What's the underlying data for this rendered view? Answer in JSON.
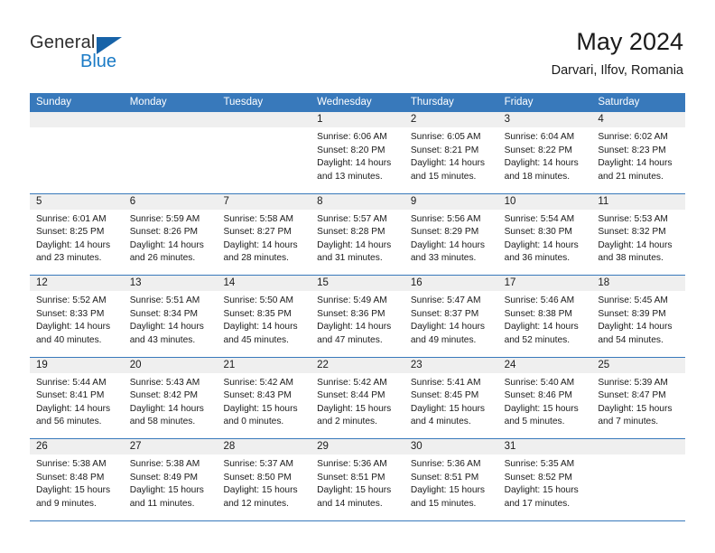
{
  "logo": {
    "word_top": "General",
    "word_bottom": "Blue",
    "triangle_color": "#1763a8",
    "blue_color": "#1b7bc6"
  },
  "header": {
    "title": "May 2024",
    "subtitle": "Darvari, Ilfov, Romania",
    "header_bg": "#3879bb",
    "header_text_color": "#ffffff",
    "daynum_bg": "#efefef"
  },
  "weekdays": [
    "Sunday",
    "Monday",
    "Tuesday",
    "Wednesday",
    "Thursday",
    "Friday",
    "Saturday"
  ],
  "weeks": [
    [
      {
        "day": "",
        "empty": true
      },
      {
        "day": "",
        "empty": true
      },
      {
        "day": "",
        "empty": true
      },
      {
        "day": "1",
        "sunrise": "Sunrise: 6:06 AM",
        "sunset": "Sunset: 8:20 PM",
        "daylight_l1": "Daylight: 14 hours",
        "daylight_l2": "and 13 minutes."
      },
      {
        "day": "2",
        "sunrise": "Sunrise: 6:05 AM",
        "sunset": "Sunset: 8:21 PM",
        "daylight_l1": "Daylight: 14 hours",
        "daylight_l2": "and 15 minutes."
      },
      {
        "day": "3",
        "sunrise": "Sunrise: 6:04 AM",
        "sunset": "Sunset: 8:22 PM",
        "daylight_l1": "Daylight: 14 hours",
        "daylight_l2": "and 18 minutes."
      },
      {
        "day": "4",
        "sunrise": "Sunrise: 6:02 AM",
        "sunset": "Sunset: 8:23 PM",
        "daylight_l1": "Daylight: 14 hours",
        "daylight_l2": "and 21 minutes."
      }
    ],
    [
      {
        "day": "5",
        "sunrise": "Sunrise: 6:01 AM",
        "sunset": "Sunset: 8:25 PM",
        "daylight_l1": "Daylight: 14 hours",
        "daylight_l2": "and 23 minutes."
      },
      {
        "day": "6",
        "sunrise": "Sunrise: 5:59 AM",
        "sunset": "Sunset: 8:26 PM",
        "daylight_l1": "Daylight: 14 hours",
        "daylight_l2": "and 26 minutes."
      },
      {
        "day": "7",
        "sunrise": "Sunrise: 5:58 AM",
        "sunset": "Sunset: 8:27 PM",
        "daylight_l1": "Daylight: 14 hours",
        "daylight_l2": "and 28 minutes."
      },
      {
        "day": "8",
        "sunrise": "Sunrise: 5:57 AM",
        "sunset": "Sunset: 8:28 PM",
        "daylight_l1": "Daylight: 14 hours",
        "daylight_l2": "and 31 minutes."
      },
      {
        "day": "9",
        "sunrise": "Sunrise: 5:56 AM",
        "sunset": "Sunset: 8:29 PM",
        "daylight_l1": "Daylight: 14 hours",
        "daylight_l2": "and 33 minutes."
      },
      {
        "day": "10",
        "sunrise": "Sunrise: 5:54 AM",
        "sunset": "Sunset: 8:30 PM",
        "daylight_l1": "Daylight: 14 hours",
        "daylight_l2": "and 36 minutes."
      },
      {
        "day": "11",
        "sunrise": "Sunrise: 5:53 AM",
        "sunset": "Sunset: 8:32 PM",
        "daylight_l1": "Daylight: 14 hours",
        "daylight_l2": "and 38 minutes."
      }
    ],
    [
      {
        "day": "12",
        "sunrise": "Sunrise: 5:52 AM",
        "sunset": "Sunset: 8:33 PM",
        "daylight_l1": "Daylight: 14 hours",
        "daylight_l2": "and 40 minutes."
      },
      {
        "day": "13",
        "sunrise": "Sunrise: 5:51 AM",
        "sunset": "Sunset: 8:34 PM",
        "daylight_l1": "Daylight: 14 hours",
        "daylight_l2": "and 43 minutes."
      },
      {
        "day": "14",
        "sunrise": "Sunrise: 5:50 AM",
        "sunset": "Sunset: 8:35 PM",
        "daylight_l1": "Daylight: 14 hours",
        "daylight_l2": "and 45 minutes."
      },
      {
        "day": "15",
        "sunrise": "Sunrise: 5:49 AM",
        "sunset": "Sunset: 8:36 PM",
        "daylight_l1": "Daylight: 14 hours",
        "daylight_l2": "and 47 minutes."
      },
      {
        "day": "16",
        "sunrise": "Sunrise: 5:47 AM",
        "sunset": "Sunset: 8:37 PM",
        "daylight_l1": "Daylight: 14 hours",
        "daylight_l2": "and 49 minutes."
      },
      {
        "day": "17",
        "sunrise": "Sunrise: 5:46 AM",
        "sunset": "Sunset: 8:38 PM",
        "daylight_l1": "Daylight: 14 hours",
        "daylight_l2": "and 52 minutes."
      },
      {
        "day": "18",
        "sunrise": "Sunrise: 5:45 AM",
        "sunset": "Sunset: 8:39 PM",
        "daylight_l1": "Daylight: 14 hours",
        "daylight_l2": "and 54 minutes."
      }
    ],
    [
      {
        "day": "19",
        "sunrise": "Sunrise: 5:44 AM",
        "sunset": "Sunset: 8:41 PM",
        "daylight_l1": "Daylight: 14 hours",
        "daylight_l2": "and 56 minutes."
      },
      {
        "day": "20",
        "sunrise": "Sunrise: 5:43 AM",
        "sunset": "Sunset: 8:42 PM",
        "daylight_l1": "Daylight: 14 hours",
        "daylight_l2": "and 58 minutes."
      },
      {
        "day": "21",
        "sunrise": "Sunrise: 5:42 AM",
        "sunset": "Sunset: 8:43 PM",
        "daylight_l1": "Daylight: 15 hours",
        "daylight_l2": "and 0 minutes."
      },
      {
        "day": "22",
        "sunrise": "Sunrise: 5:42 AM",
        "sunset": "Sunset: 8:44 PM",
        "daylight_l1": "Daylight: 15 hours",
        "daylight_l2": "and 2 minutes."
      },
      {
        "day": "23",
        "sunrise": "Sunrise: 5:41 AM",
        "sunset": "Sunset: 8:45 PM",
        "daylight_l1": "Daylight: 15 hours",
        "daylight_l2": "and 4 minutes."
      },
      {
        "day": "24",
        "sunrise": "Sunrise: 5:40 AM",
        "sunset": "Sunset: 8:46 PM",
        "daylight_l1": "Daylight: 15 hours",
        "daylight_l2": "and 5 minutes."
      },
      {
        "day": "25",
        "sunrise": "Sunrise: 5:39 AM",
        "sunset": "Sunset: 8:47 PM",
        "daylight_l1": "Daylight: 15 hours",
        "daylight_l2": "and 7 minutes."
      }
    ],
    [
      {
        "day": "26",
        "sunrise": "Sunrise: 5:38 AM",
        "sunset": "Sunset: 8:48 PM",
        "daylight_l1": "Daylight: 15 hours",
        "daylight_l2": "and 9 minutes."
      },
      {
        "day": "27",
        "sunrise": "Sunrise: 5:38 AM",
        "sunset": "Sunset: 8:49 PM",
        "daylight_l1": "Daylight: 15 hours",
        "daylight_l2": "and 11 minutes."
      },
      {
        "day": "28",
        "sunrise": "Sunrise: 5:37 AM",
        "sunset": "Sunset: 8:50 PM",
        "daylight_l1": "Daylight: 15 hours",
        "daylight_l2": "and 12 minutes."
      },
      {
        "day": "29",
        "sunrise": "Sunrise: 5:36 AM",
        "sunset": "Sunset: 8:51 PM",
        "daylight_l1": "Daylight: 15 hours",
        "daylight_l2": "and 14 minutes."
      },
      {
        "day": "30",
        "sunrise": "Sunrise: 5:36 AM",
        "sunset": "Sunset: 8:51 PM",
        "daylight_l1": "Daylight: 15 hours",
        "daylight_l2": "and 15 minutes."
      },
      {
        "day": "31",
        "sunrise": "Sunrise: 5:35 AM",
        "sunset": "Sunset: 8:52 PM",
        "daylight_l1": "Daylight: 15 hours",
        "daylight_l2": "and 17 minutes."
      },
      {
        "day": "",
        "empty": true
      }
    ]
  ]
}
